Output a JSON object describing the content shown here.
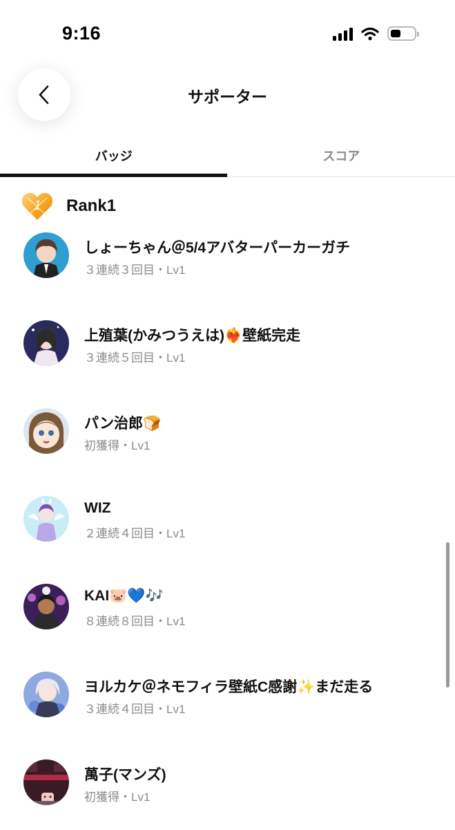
{
  "status_bar": {
    "time": "9:16"
  },
  "header": {
    "title": "サポーター"
  },
  "tabs": [
    {
      "label": "バッジ",
      "active": true
    },
    {
      "label": "スコア",
      "active": false
    }
  ],
  "rank": {
    "title": "Rank1",
    "badge_icon": "orange-heart-badge",
    "badge_number": "1"
  },
  "supporters": [
    {
      "name": "しょーちゃん＠5/4アバターパーカーガチ",
      "detail": "３連続３回目・Lv1"
    },
    {
      "name": "上殖葉(かみつうえは)❤️‍🔥壁紙完走",
      "detail": "３連続５回目・Lv1"
    },
    {
      "name": "パン治郎🍞",
      "detail": "初獲得・Lv1"
    },
    {
      "name": "WIZ",
      "detail": "２連続４回目・Lv1"
    },
    {
      "name": "KAI🐷💙🎶",
      "detail": "８連続８回目・Lv1"
    },
    {
      "name": "ヨルカケ＠ネモフィラ壁紙C感謝✨まだ走る",
      "detail": "３連続４回目・Lv1"
    },
    {
      "name": "萬子(マンズ)",
      "detail": "初獲得・Lv1"
    }
  ],
  "colors": {
    "accent": "#111111",
    "muted": "#8a8a8a",
    "badge_orange": "#f5a623"
  }
}
